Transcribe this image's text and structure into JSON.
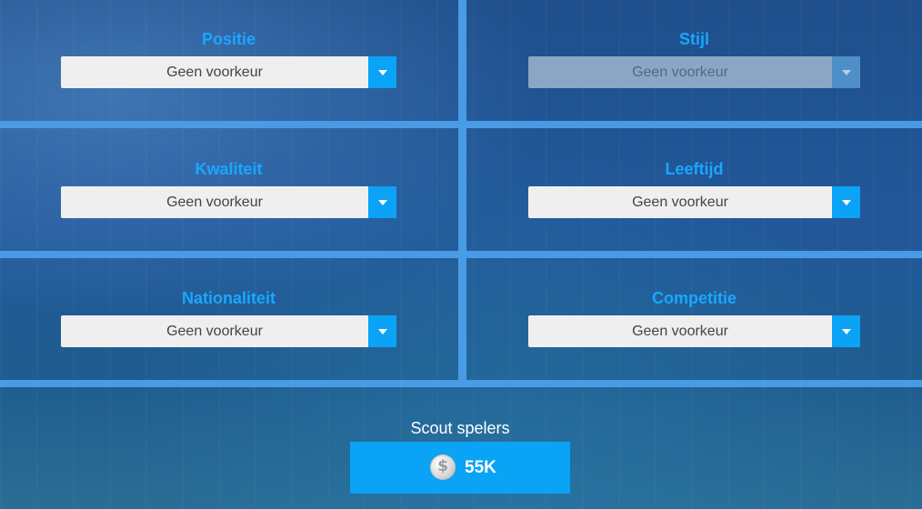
{
  "filters": [
    {
      "label": "Positie",
      "value": "Geen voorkeur",
      "enabled": true
    },
    {
      "label": "Stijl",
      "value": "Geen voorkeur",
      "enabled": false
    },
    {
      "label": "Kwaliteit",
      "value": "Geen voorkeur",
      "enabled": true
    },
    {
      "label": "Leeftijd",
      "value": "Geen voorkeur",
      "enabled": true
    },
    {
      "label": "Nationaliteit",
      "value": "Geen voorkeur",
      "enabled": true
    },
    {
      "label": "Competitie",
      "value": "Geen voorkeur",
      "enabled": true
    }
  ],
  "scout": {
    "label": "Scout spelers",
    "price": "55K",
    "icon": "silver-coin-icon"
  },
  "colors": {
    "accent": "#0aa3f5",
    "label": "#1aa7ff",
    "grid": "#4a9be6"
  }
}
